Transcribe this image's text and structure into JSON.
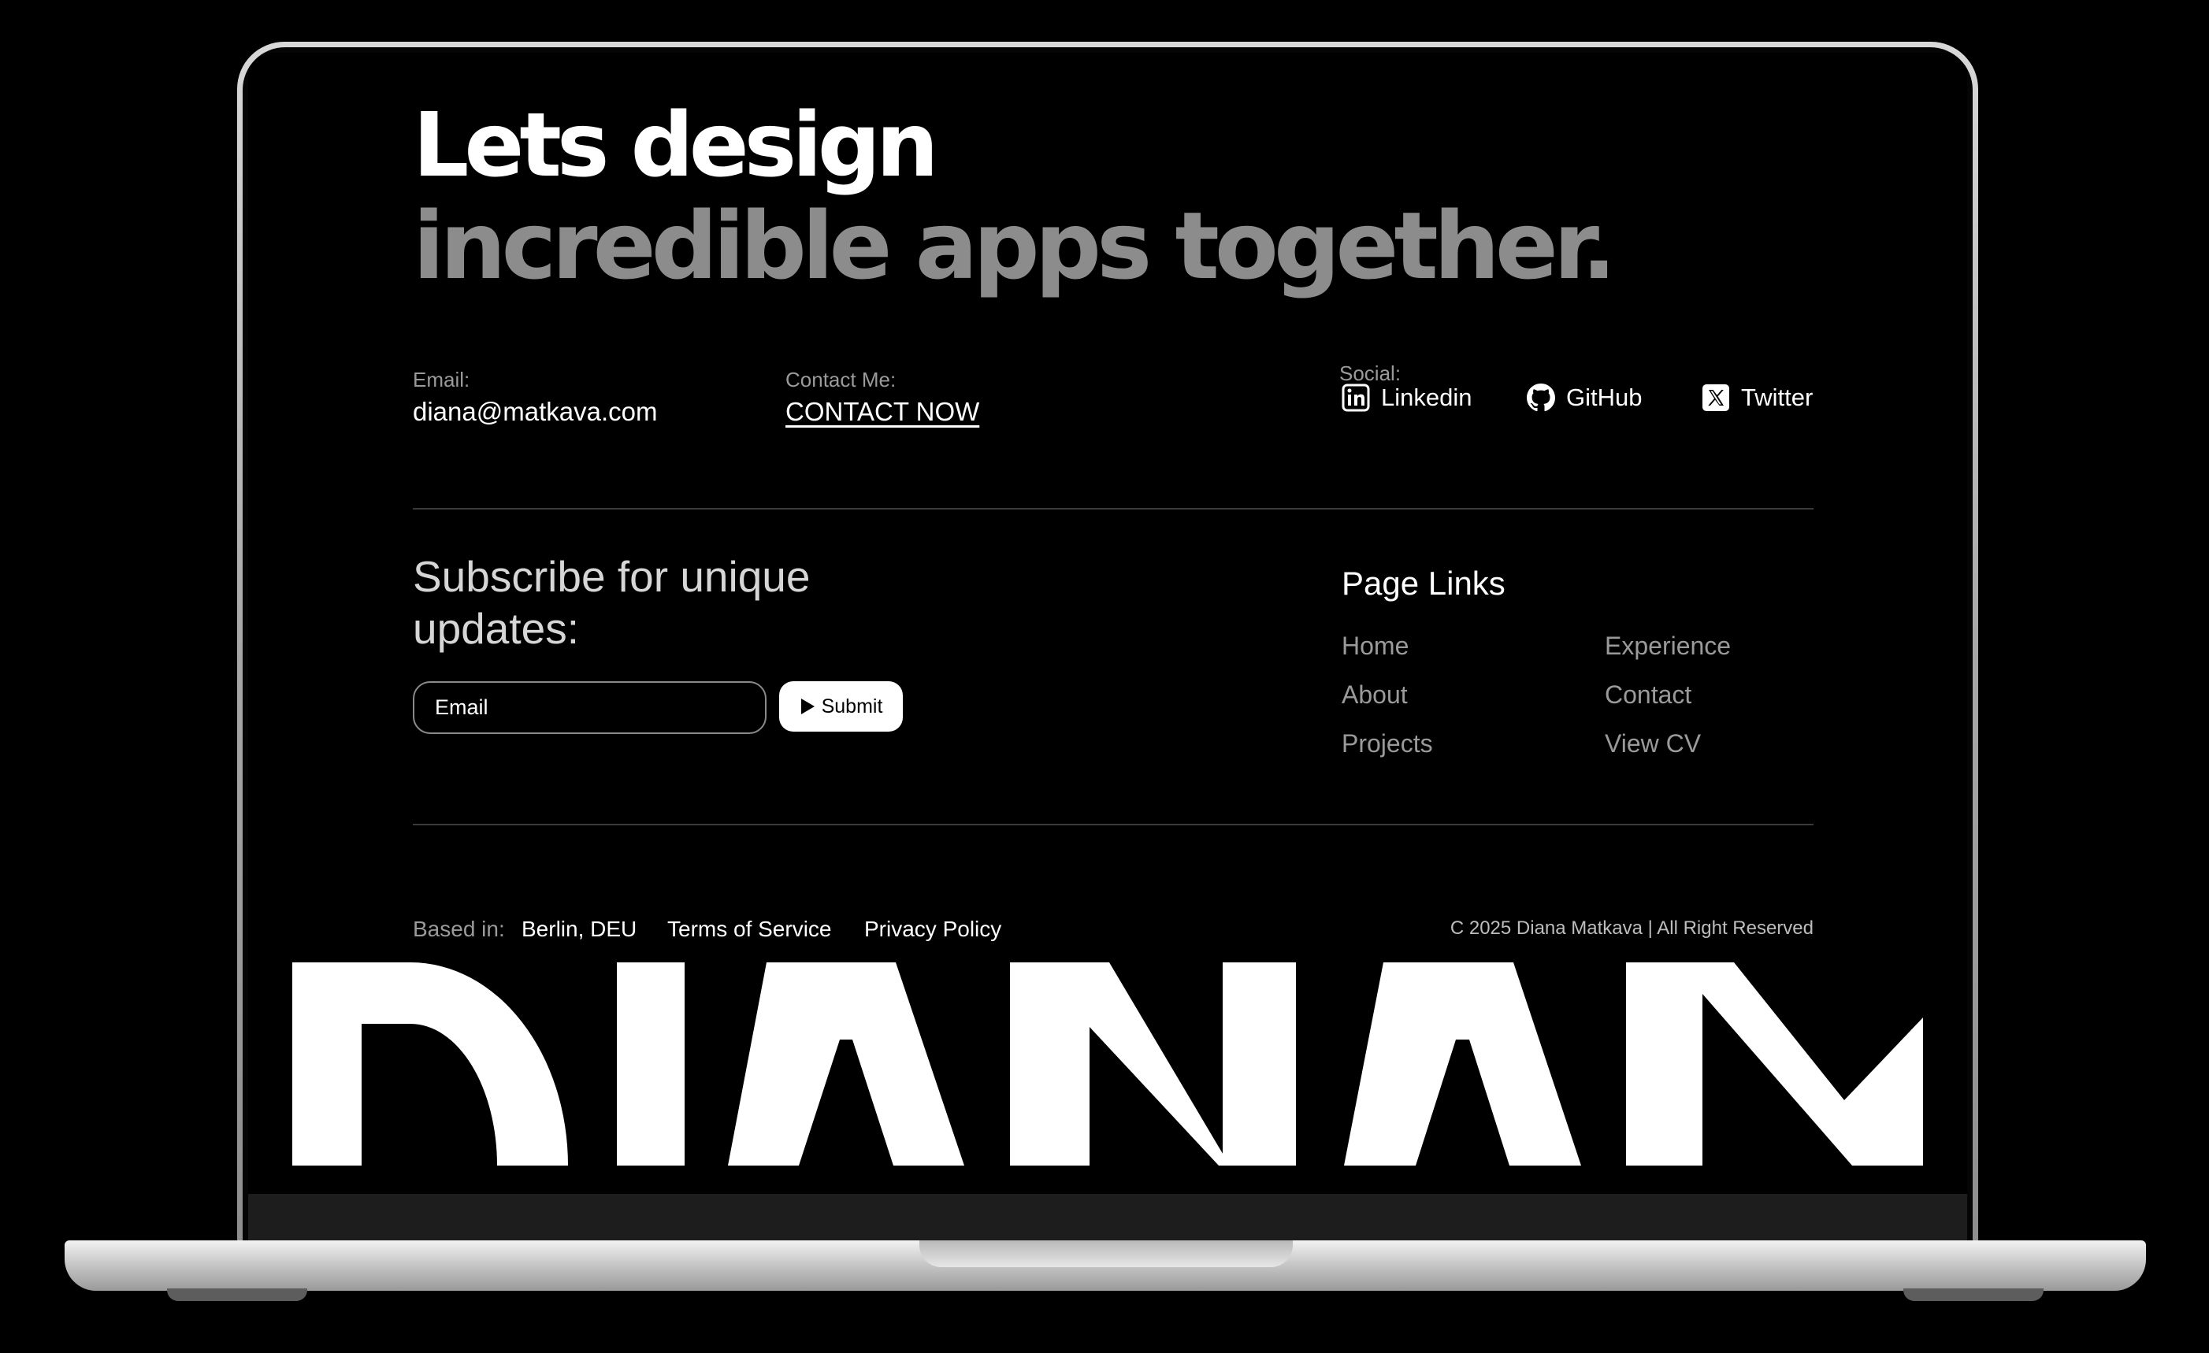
{
  "hero": {
    "line1": "Lets design",
    "line2": "incredible apps together."
  },
  "contact": {
    "email_label": "Email:",
    "email_value": "diana@matkava.com",
    "contact_label": "Contact Me:",
    "contact_link": "CONTACT NOW",
    "social_label": "Social:",
    "socials": [
      {
        "label": "Linkedin",
        "icon": "linkedin-icon"
      },
      {
        "label": "GitHub",
        "icon": "github-icon"
      },
      {
        "label": "Twitter",
        "icon": "x-twitter-icon"
      }
    ]
  },
  "subscribe": {
    "title": "Subscribe for unique updates:",
    "input_placeholder": "Email",
    "submit_label": "Submit",
    "submit_icon": "play-icon"
  },
  "page_links": {
    "title": "Page Links",
    "items": [
      "Home",
      "Experience",
      "About",
      "Contact",
      "Projects",
      "View CV"
    ]
  },
  "footer": {
    "based_in_label": "Based in:",
    "location": "Berlin, DEU",
    "terms": "Terms of Service",
    "privacy": "Privacy Policy",
    "copyright": "C 2025 Diana Matkava | All Right Reserved"
  },
  "wordmark": "DIANAM",
  "colors": {
    "background": "#000000",
    "text_primary": "#ffffff",
    "text_muted": "#9a9a9a",
    "hero_secondary": "#8c8c8c",
    "divider": "#3a3a3a"
  }
}
